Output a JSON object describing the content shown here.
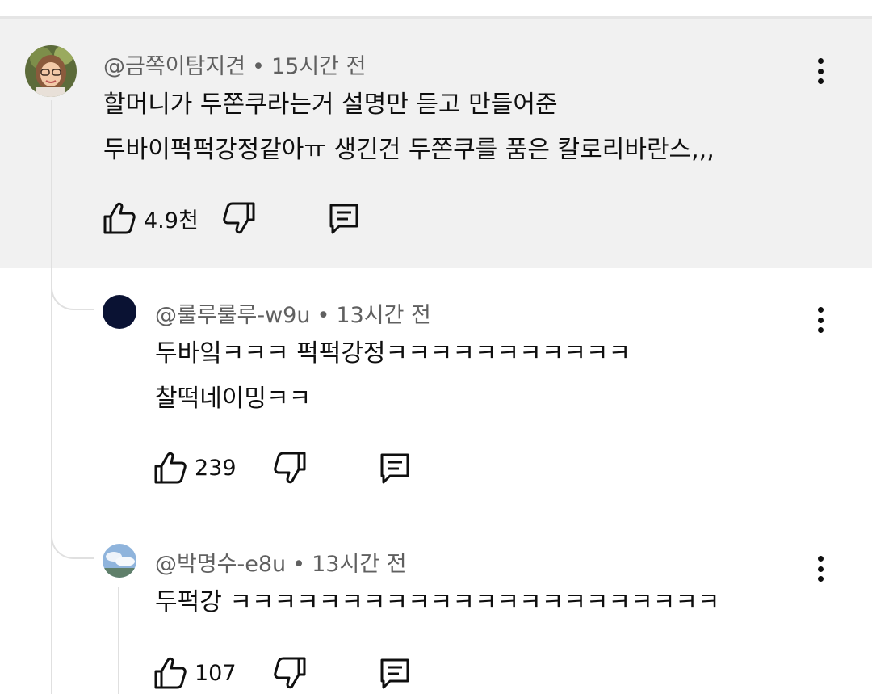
{
  "comments": [
    {
      "author": "@금쪽이탐지견",
      "time": "15시간 전",
      "lines": [
        "할머니가 두쫀쿠라는거 설명만 듣고 만들어준",
        "두바이퍽퍽강정같아ㅠ 생긴건 두쫀쿠를 품은 칼로리바란스,,,"
      ],
      "likes": "4.9천",
      "avatar_icon": "profile-photo",
      "highlighted": true
    },
    {
      "author": "@룰루룰루-w9u",
      "time": "13시간 전",
      "lines": [
        "두바잌ㅋㅋㅋ 퍽퍽강정ㅋㅋㅋㅋㅋㅋㅋㅋㅋㅋㅋ",
        "찰떡네이밍ㅋㅋ"
      ],
      "likes": "239",
      "avatar_color": "#0a1233"
    },
    {
      "author": "@박명수-e8u",
      "time": "13시간 전",
      "lines": [
        "두퍽강 ㅋㅋㅋㅋㅋㅋㅋㅋㅋㅋㅋㅋㅋㅋㅋㅋㅋㅋㅋㅋㅋㅋ"
      ],
      "likes": "107",
      "avatar_icon": "sky-photo"
    }
  ],
  "separator": "•",
  "icons": {
    "like": "thumbs-up-icon",
    "dislike": "thumbs-down-icon",
    "reply": "comment-icon",
    "menu": "more-vert-icon"
  },
  "colors": {
    "highlight_bg": "#f1f1f1",
    "meta_text": "#606060",
    "thread_line": "#e0e0e0"
  }
}
